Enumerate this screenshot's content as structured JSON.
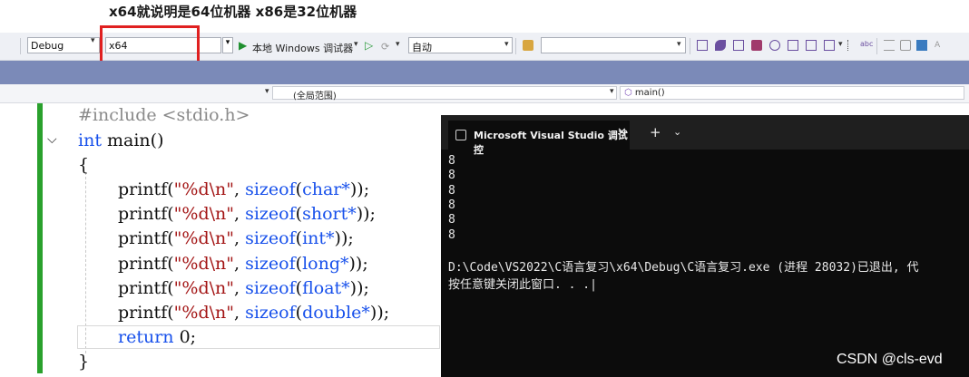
{
  "annotation": "x64就说明是64位机器 x86是32位机器",
  "toolbar": {
    "config": "Debug",
    "platform": "x64",
    "run_label": "本地 Windows 调试器",
    "auto_label": "自动"
  },
  "navbar": {
    "scope": "(全局范围)",
    "member": "main()"
  },
  "code": {
    "include": "#include <stdio.h>",
    "signature_kw": "int",
    "signature_rest": " main()",
    "open_brace": "{",
    "close_brace": "}",
    "lines": [
      {
        "fmt": "\"%d\\n\"",
        "type": "char*"
      },
      {
        "fmt": "\"%d\\n\"",
        "type": "short*"
      },
      {
        "fmt": "\"%d\\n\"",
        "type": "int*"
      },
      {
        "fmt": "\"%d\\n\"",
        "type": "long*"
      },
      {
        "fmt": "\"%d\\n\"",
        "type": "float*"
      },
      {
        "fmt": "\"%d\\n\"",
        "type": "double*"
      }
    ],
    "printf": "printf",
    "sizeof": "sizeof",
    "return_kw": "return",
    "return_val": " 0;"
  },
  "console": {
    "title": "Microsoft Visual Studio 调试控",
    "outputs": [
      "8",
      "8",
      "8",
      "8",
      "8",
      "8"
    ],
    "exit_line": "D:\\Code\\VS2022\\C语言复习\\x64\\Debug\\C语言复习.exe (进程 28032)已退出, 代",
    "prompt_line": "按任意键关闭此窗口. . ."
  },
  "watermark": "CSDN @cls-evd"
}
